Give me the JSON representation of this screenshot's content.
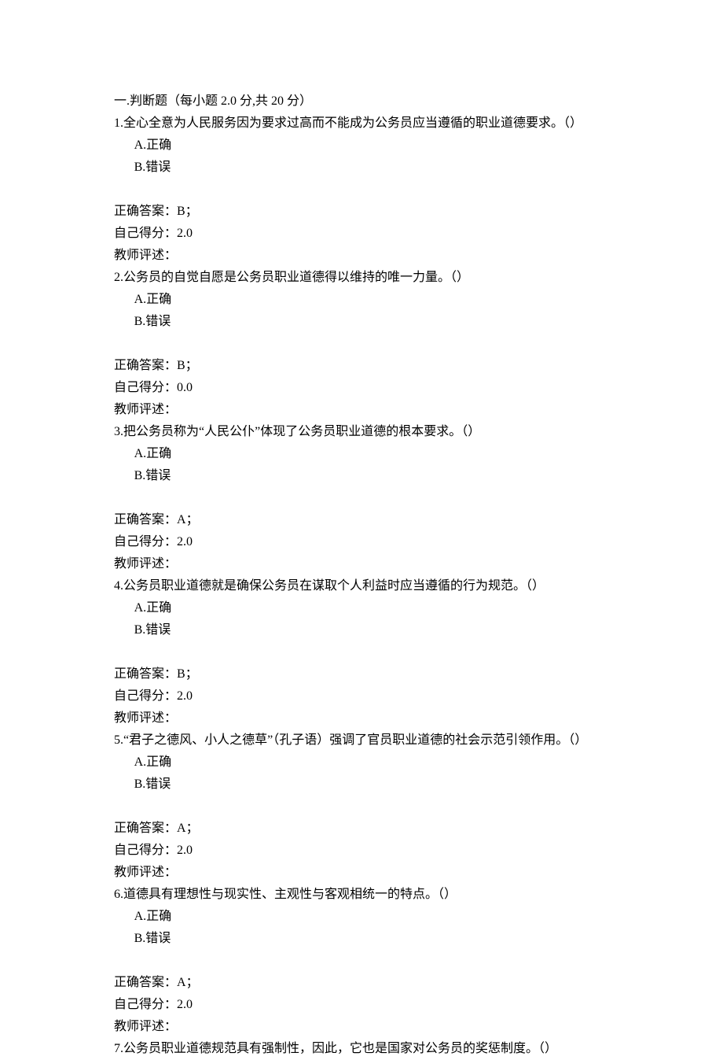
{
  "section_title": "一.判断题（每小题 2.0 分,共 20 分）",
  "option_labels": {
    "A": "A.正确",
    "B": "B.错误"
  },
  "answer_prefix": "正确答案：",
  "score_prefix": "自己得分：",
  "comment_prefix": "教师评述：",
  "questions": [
    {
      "text": "1.全心全意为人民服务因为要求过高而不能成为公务员应当遵循的职业道德要求。（）",
      "answer": "B；",
      "score": "2.0"
    },
    {
      "text": "2.公务员的自觉自愿是公务员职业道德得以维持的唯一力量。（）",
      "answer": "B；",
      "score": "0.0"
    },
    {
      "text": "3.把公务员称为“人民公仆”体现了公务员职业道德的根本要求。（）",
      "answer": "A；",
      "score": "2.0"
    },
    {
      "text": "4.公务员职业道德就是确保公务员在谋取个人利益时应当遵循的行为规范。（）",
      "answer": "B；",
      "score": "2.0"
    },
    {
      "text": "5.“君子之德风、小人之德草”（孔子语）强调了官员职业道德的社会示范引领作用。（）",
      "answer": "A；",
      "score": "2.0"
    },
    {
      "text": "6.道德具有理想性与现实性、主观性与客观相统一的特点。（）",
      "answer": "A；",
      "score": "2.0"
    },
    {
      "text": "7.公务员职业道德规范具有强制性，因此，它也是国家对公务员的奖惩制度。（）"
    }
  ]
}
